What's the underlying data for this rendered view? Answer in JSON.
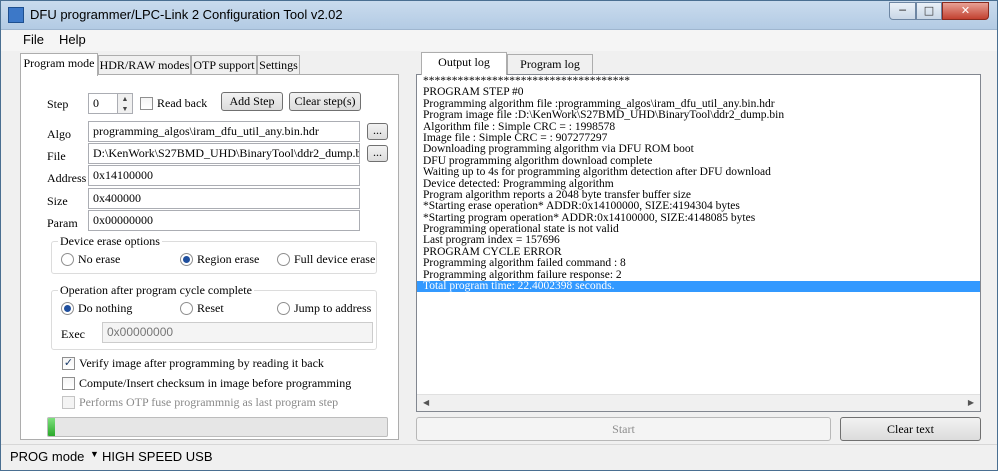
{
  "window": {
    "title": "DFU programmer/LPC-Link 2 Configuration Tool v2.02",
    "min": "─",
    "max": "□",
    "close": "✕"
  },
  "menu": {
    "file": "File",
    "help": "Help"
  },
  "left_tabs": [
    "Program mode",
    "HDR/RAW modes",
    "OTP support",
    "Settings"
  ],
  "program": {
    "step_label": "Step",
    "step_value": "0",
    "read_back_label": "Read back",
    "read_back_checked": false,
    "add_step": "Add Step",
    "clear_steps": "Clear step(s)",
    "algo_label": "Algo",
    "algo_value": "programming_algos\\iram_dfu_util_any.bin.hdr",
    "file_label": "File",
    "file_value": "D:\\KenWork\\S27BMD_UHD\\BinaryTool\\ddr2_dump.bin",
    "browse": "...",
    "address_label": "Address",
    "address_value": "0x14100000",
    "size_label": "Size",
    "size_value": "0x400000",
    "param_label": "Param",
    "param_value": "0x00000000"
  },
  "erase_group": {
    "title": "Device erase options",
    "options": [
      "No erase",
      "Region erase",
      "Full device erase"
    ],
    "selected": 1
  },
  "after_group": {
    "title": "Operation after program cycle complete",
    "options": [
      "Do nothing",
      "Reset",
      "Jump to address"
    ],
    "selected": 0,
    "exec_label": "Exec",
    "exec_value": "0x00000000"
  },
  "checks": {
    "verify": "Verify image after programming by reading it back",
    "checksum": "Compute/Insert checksum in image before programming",
    "otp": "Performs OTP fuse programmnig as last program step"
  },
  "progress": 0.02,
  "right_tabs": [
    "Output log",
    "Program log"
  ],
  "log_lines": [
    "************************************",
    "PROGRAM STEP #0",
    "Programming algorithm file :programming_algos\\iram_dfu_util_any.bin.hdr",
    "Program image file :D:\\KenWork\\S27BMD_UHD\\BinaryTool\\ddr2_dump.bin",
    "Algorithm file : Simple CRC = : 1998578",
    "Image file : Simple CRC = : 907277297",
    "Downloading programming algorithm via DFU ROM boot",
    "DFU programming algorithm download complete",
    "Waiting up to 4s for programming algorithm detection after DFU download",
    "Device detected: Programming algorithm",
    "Program algorithm reports a 2048 byte transfer buffer size",
    "*Starting erase operation* ADDR:0x14100000, SIZE:4194304 bytes",
    "*Starting program operation* ADDR:0x14100000, SIZE:4148085 bytes",
    "Programming operational state is not valid",
    "Last program index = 157696",
    "PROGRAM CYCLE ERROR",
    "Programming algorithm failed command  : 8",
    "Programming algorithm failure response: 2",
    "Total program time:  22.4002398 seconds."
  ],
  "selected_line": 18,
  "actions": {
    "start": "Start",
    "clear_text": "Clear text"
  },
  "status": {
    "mode": "PROG mode",
    "usb": "HIGH SPEED USB"
  }
}
